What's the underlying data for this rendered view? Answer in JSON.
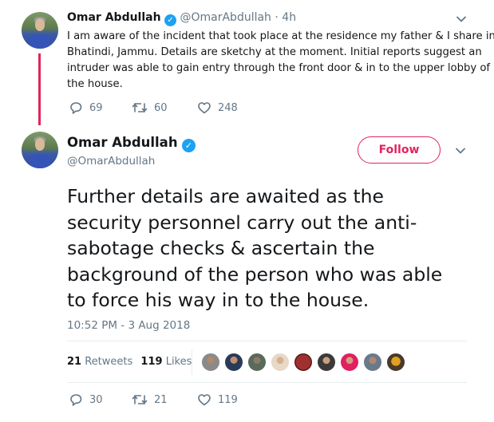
{
  "parent_tweet": {
    "author_name": "Omar Abdullah",
    "handle": "@OmarAbdullah",
    "time": "4h",
    "text_lines": [
      "I am aware of the incident that took place at the residence my father & I share in",
      "Bhatindi, Jammu. Details are sketchy at the moment. Initial reports suggest an",
      "intruder was able to gain entry through the front door & in to the upper lobby of",
      "the house."
    ],
    "replies": "69",
    "retweets": "60",
    "likes": "248"
  },
  "main_tweet": {
    "author_name": "Omar Abdullah",
    "handle": "@OmarAbdullah",
    "follow_label": "Follow",
    "text_lines": [
      "Further details are awaited as the",
      "security personnel carry out the anti-",
      "sabotage checks & ascertain the",
      "background of the person who was able",
      "to force his way in to the house."
    ],
    "timestamp": "10:52 PM - 3 Aug 2018",
    "retweet_count": "21",
    "retweet_label": "Retweets",
    "like_count": "119",
    "like_label": "Likes",
    "replies": "30",
    "retweets": "21",
    "likes": "119"
  },
  "colors": {
    "accent_pink": "#e0245e",
    "verified_blue": "#1da1f2",
    "muted": "#657786",
    "text": "#14171a"
  },
  "icons": {
    "verified": "✓"
  }
}
